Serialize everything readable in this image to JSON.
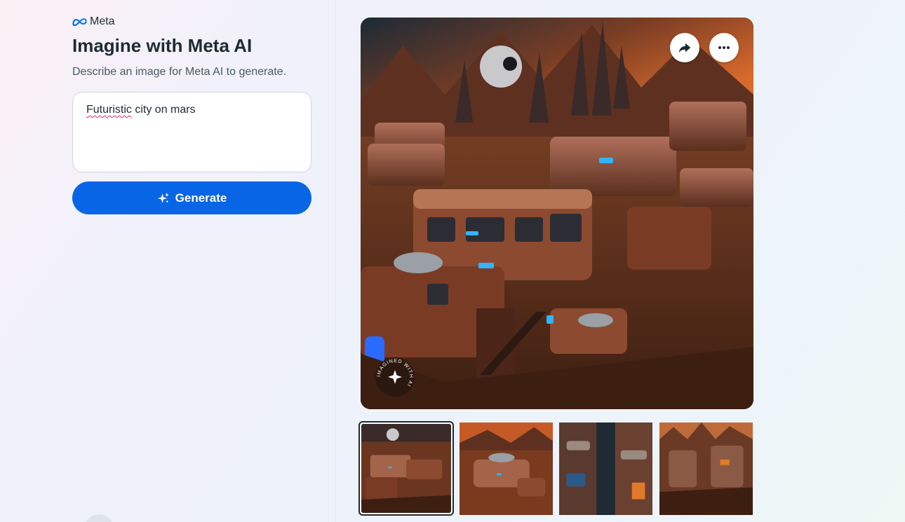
{
  "brand": {
    "name": "Meta",
    "icon": "meta-infinity-icon"
  },
  "page": {
    "title": "Imagine with Meta AI",
    "subtitle": "Describe an image for Meta AI to generate."
  },
  "prompt": {
    "value_misspelled_word": "Futuristic",
    "value_rest": " city on mars"
  },
  "generate_button": {
    "label": "Generate",
    "icon": "sparkle-icon"
  },
  "image_actions": {
    "share_icon": "share-arrow-icon",
    "more_icon": "more-dots-icon"
  },
  "watermark": {
    "text": "IMAGINED WITH AI"
  },
  "thumbnails": [
    {
      "selected": true
    },
    {
      "selected": false
    },
    {
      "selected": false
    },
    {
      "selected": false
    }
  ],
  "colors": {
    "accent": "#0866e6",
    "text": "#1c2b33",
    "muted": "#4b5a63"
  }
}
